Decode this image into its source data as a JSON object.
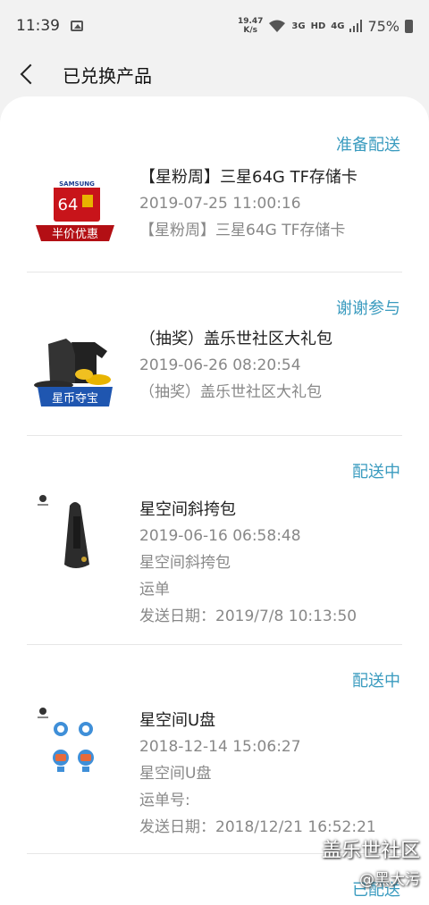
{
  "status_bar": {
    "time": "11:39",
    "speed_value": "19.47",
    "speed_unit": "K/s",
    "signal_3g": "3G",
    "hd": "HD",
    "signal_4g": "4G",
    "battery": "75%"
  },
  "header": {
    "title": "已兑换产品"
  },
  "orders": [
    {
      "status": "准备配送",
      "badge": "半价优惠",
      "brand": "SAMSUNG",
      "capacity": "64",
      "name": "【星粉周】三星64G TF存储卡",
      "datetime": "2019-07-25 11:00:16",
      "detail": "【星粉周】三星64G TF存储卡"
    },
    {
      "status": "谢谢参与",
      "badge": "星币夺宝",
      "name": "（抽奖）盖乐世社区大礼包",
      "datetime": "2019-06-26 08:20:54",
      "detail": "（抽奖）盖乐世社区大礼包"
    },
    {
      "status": "配送中",
      "name": "星空间斜挎包",
      "datetime": "2019-06-16 06:58:48",
      "detail": "星空间斜挎包",
      "tracking": "运单",
      "ship_date": "发送日期：2019/7/8 10:13:50"
    },
    {
      "status": "配送中",
      "name": "星空间U盘",
      "datetime": "2018-12-14 15:06:27",
      "detail": "星空间U盘",
      "tracking": "运单号:",
      "ship_date": "发送日期：2018/12/21 16:52:21"
    },
    {
      "status": "已配送"
    }
  ],
  "watermark": {
    "site": "盖乐世社区",
    "user": "@黑大污"
  }
}
